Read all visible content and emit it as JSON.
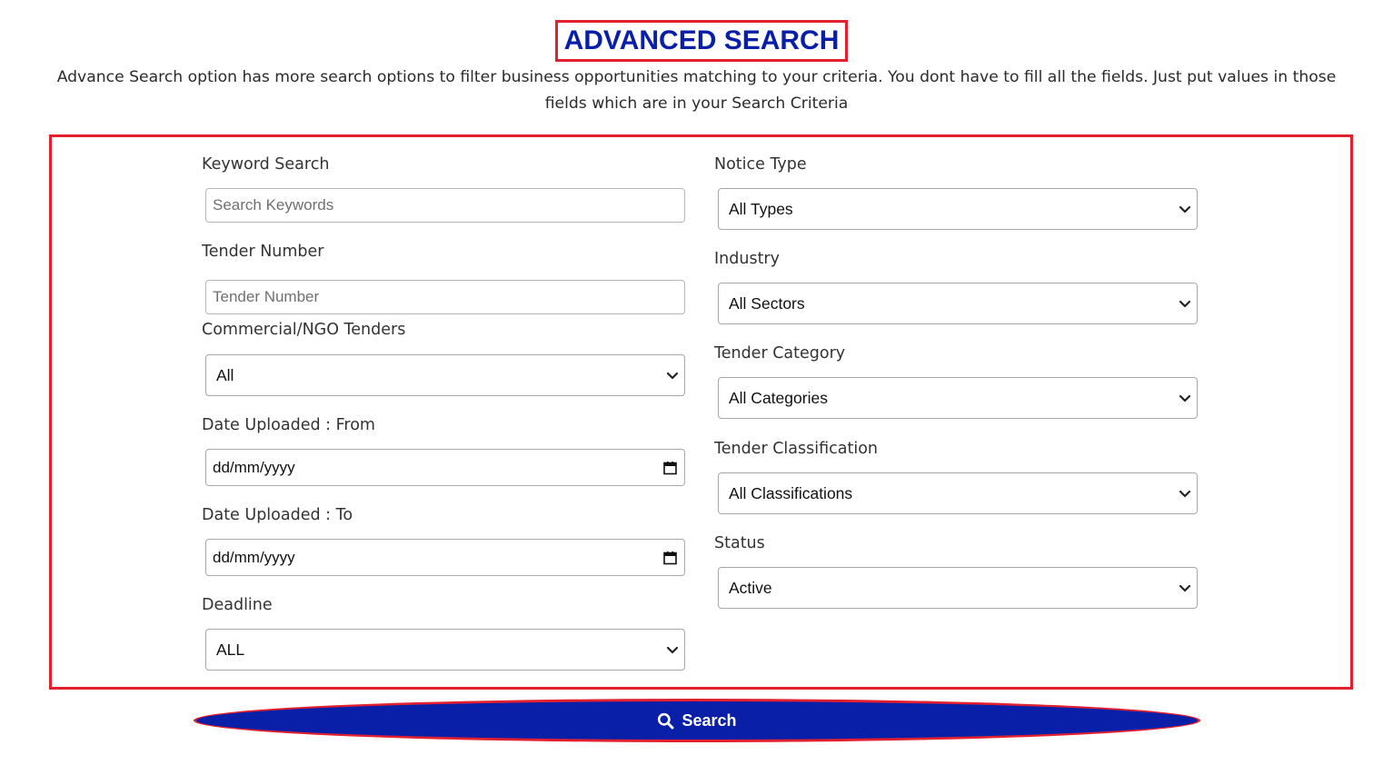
{
  "header": {
    "title": "ADVANCED SEARCH",
    "description": "Advance Search option has more search options to filter business opportunities matching to your criteria. You dont have to fill all the fields. Just put values in those fields which are in your Search Criteria"
  },
  "form": {
    "keyword": {
      "label": "Keyword Search",
      "placeholder": "Search Keywords"
    },
    "tender_number": {
      "label": "Tender Number",
      "placeholder": "Tender Number"
    },
    "commercial": {
      "label": "Commercial/NGO Tenders",
      "value": "All"
    },
    "date_from": {
      "label": "Date Uploaded : From",
      "value": "dd/mm/yyyy"
    },
    "date_to": {
      "label": "Date Uploaded : To",
      "value": "dd/mm/yyyy"
    },
    "deadline": {
      "label": "Deadline",
      "value": "ALL"
    },
    "notice_type": {
      "label": "Notice Type",
      "value": "All Types"
    },
    "industry": {
      "label": "Industry",
      "value": "All Sectors"
    },
    "tender_category": {
      "label": "Tender Category",
      "value": "All Categories"
    },
    "tender_classification": {
      "label": "Tender Classification",
      "value": "All Classifications"
    },
    "status": {
      "label": "Status",
      "value": "Active"
    }
  },
  "search_button": {
    "label": "Search",
    "icon": "search-icon"
  },
  "colors": {
    "accent": "#0a1fa8",
    "highlight": "#e3202d"
  }
}
